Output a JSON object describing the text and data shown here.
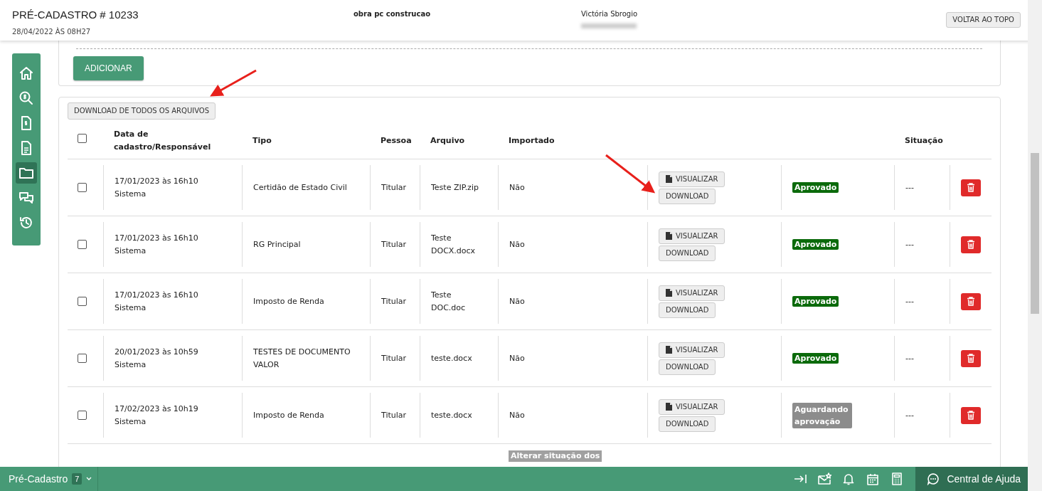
{
  "header": {
    "title": "PRÉ-CADASTRO # 10233",
    "date": "28/04/2022 ÀS 08H27",
    "project": "obra pc construcao",
    "person": "Victória Sbrogio",
    "top_button": "VOLTAR AO TOPO"
  },
  "sidebar": [
    {
      "selected": false
    },
    {
      "selected": false
    },
    {
      "selected": false
    },
    {
      "selected": false
    },
    {
      "selected": true
    },
    {
      "selected": false
    },
    {
      "selected": false
    }
  ],
  "add_button": "ADICIONAR",
  "download_all_button": "DOWNLOAD DE TODOS OS ARQUIVOS",
  "table": {
    "select_all_checked": false,
    "columns": [
      "Data de cadastro/Responsável",
      "Tipo",
      "Pessoa",
      "Arquivo",
      "Importado",
      "Situação"
    ],
    "rows": [
      {
        "checked": false,
        "date": "17/01/2023 às 16h10",
        "responsible": "Sistema",
        "type": "Certidão de Estado Civil",
        "person": "Titular",
        "file": "Teste ZIP.zip",
        "imported": "Não",
        "view": "VISUALIZAR",
        "download": "DOWNLOAD",
        "status": {
          "kind": "approved",
          "label": "Aprovado"
        },
        "situation": "---"
      },
      {
        "checked": false,
        "date": "17/01/2023 às 16h10",
        "responsible": "Sistema",
        "type": "RG Principal",
        "person": "Titular",
        "file": "Teste DOCX.docx",
        "imported": "Não",
        "view": "VISUALIZAR",
        "download": "DOWNLOAD",
        "status": {
          "kind": "approved",
          "label": "Aprovado"
        },
        "situation": "---"
      },
      {
        "checked": false,
        "date": "17/01/2023 às 16h10",
        "responsible": "Sistema",
        "type": "Imposto de Renda",
        "person": "Titular",
        "file": "Teste DOC.doc",
        "imported": "Não",
        "view": "VISUALIZAR",
        "download": "DOWNLOAD",
        "status": {
          "kind": "approved",
          "label": "Aprovado"
        },
        "situation": "---"
      },
      {
        "checked": false,
        "date": "20/01/2023 às 10h59",
        "responsible": "Sistema",
        "type": "TESTES DE DOCUMENTO VALOR",
        "person": "Titular",
        "file": "teste.docx",
        "imported": "Não",
        "view": "VISUALIZAR",
        "download": "DOWNLOAD",
        "status": {
          "kind": "approved",
          "label": "Aprovado"
        },
        "situation": "---"
      },
      {
        "checked": false,
        "date": "17/02/2023 às 10h19",
        "responsible": "Sistema",
        "type": "Imposto de Renda",
        "person": "Titular",
        "file": "teste.docx",
        "imported": "Não",
        "view": "VISUALIZAR",
        "download": "DOWNLOAD",
        "status": {
          "kind": "pending",
          "label": "Aguardando aprovação"
        },
        "situation": "---"
      }
    ],
    "bulk_status_button": "Alterar situação dos"
  },
  "footer": {
    "module": "Pré-Cadastro",
    "count": "7",
    "help": "Central de Ajuda"
  }
}
